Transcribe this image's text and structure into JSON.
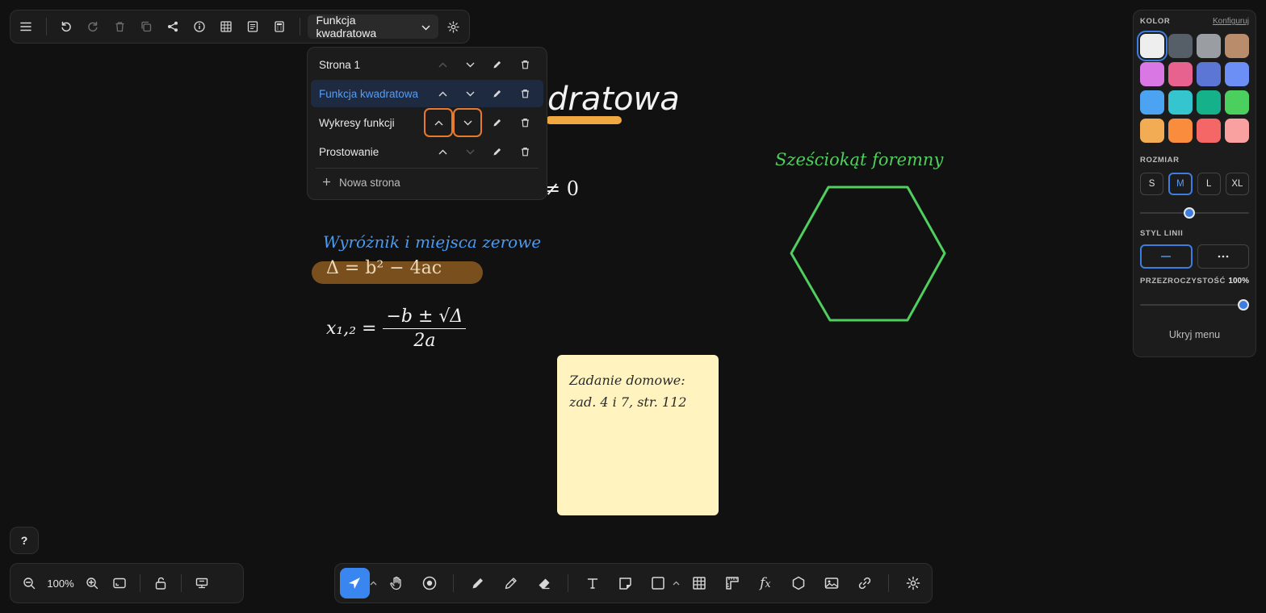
{
  "toolbar": {
    "current_page": "Funkcja kwadratowa",
    "icons": [
      "menu-icon",
      "undo-icon",
      "redo-icon",
      "trash-icon",
      "duplicate-icon",
      "share-icon",
      "info-icon",
      "grid-icon",
      "notes-icon",
      "calculator-icon"
    ]
  },
  "pages": {
    "items": [
      {
        "label": "Strona 1",
        "active": false
      },
      {
        "label": "Funkcja kwadratowa",
        "active": true
      },
      {
        "label": "Wykresy funkcji",
        "active": false
      },
      {
        "label": "Prostowanie",
        "active": false
      }
    ],
    "new_page_label": "Nowa strona"
  },
  "props": {
    "color_title": "KOLOR",
    "configure_label": "Konfiguruj",
    "colors": [
      "#eeeeee",
      "#565e68",
      "#9a9ea3",
      "#b98d6c",
      "#d977e4",
      "#e8628f",
      "#5c76d6",
      "#6b8ff4",
      "#4ba3f2",
      "#35c5cf",
      "#14b18b",
      "#4bcf5f",
      "#f2ad54",
      "#f98d3d",
      "#f56767",
      "#f9a0a0"
    ],
    "selected_color": 0,
    "size_title": "ROZMIAR",
    "sizes": [
      "S",
      "M",
      "L",
      "XL"
    ],
    "selected_size": "M",
    "size_slider": 0.45,
    "line_style_title": "STYL LINII",
    "opacity_title": "PRZEZROCZYSTOŚĆ",
    "opacity_value": "100%",
    "opacity_slider": 1.0,
    "hide_menu_label": "Ukryj menu"
  },
  "canvas": {
    "title_fragment": "dratowa",
    "neq_fragment": "≠ 0",
    "delta_heading": "Wyróżnik i miejsca zerowe",
    "delta_formula": "Δ = b² − 4ac",
    "roots_lhs": "x₁,₂ =",
    "roots_num": "−b ± √Δ",
    "roots_den": "2a",
    "sticky_line1": "Zadanie domowe:",
    "sticky_line2": "zad. 4 i 7, str. 112",
    "hex_title": "Sześciokąt foremny",
    "colors": {
      "accent_orange": "#f0a840",
      "heading_blue": "#4a9af0",
      "hex_green": "#4fcf5e",
      "sticky": "#fff3bf"
    }
  },
  "zoom": {
    "value": "100%",
    "help": "?"
  }
}
